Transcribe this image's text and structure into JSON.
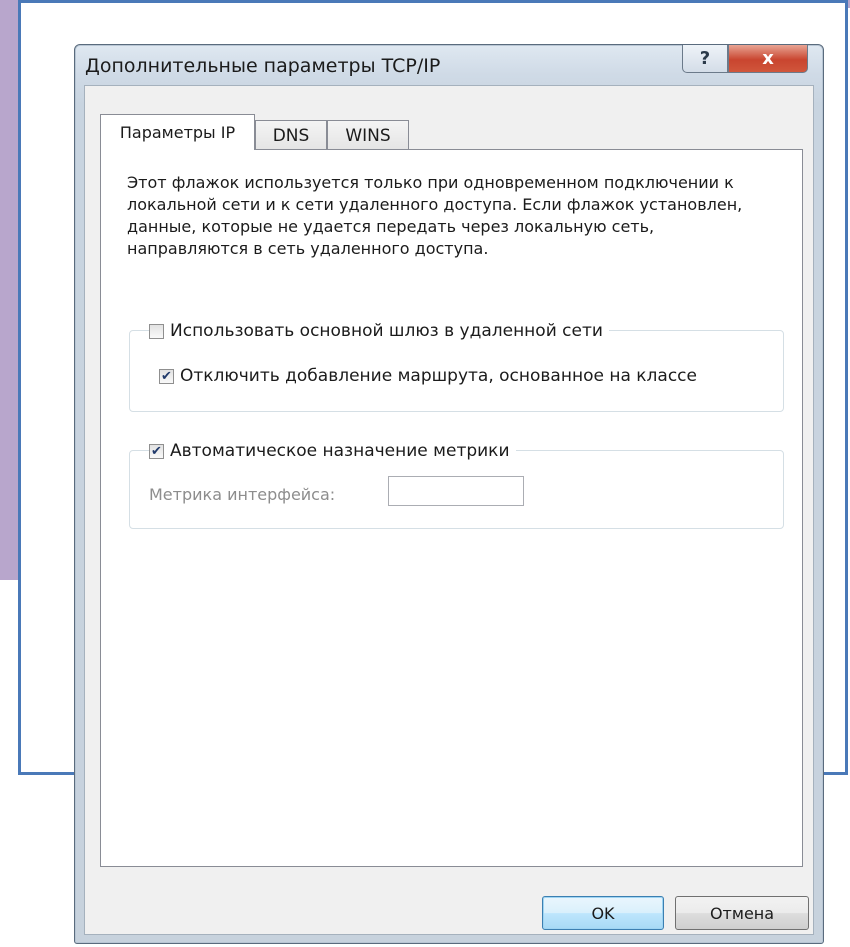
{
  "window": {
    "title": "Дополнительные параметры TCP/IP",
    "help_glyph": "?",
    "close_glyph": "x"
  },
  "tabs": [
    {
      "label": "Параметры IP",
      "active": true
    },
    {
      "label": "DNS",
      "active": false
    },
    {
      "label": "WINS",
      "active": false
    }
  ],
  "panel": {
    "description": "Этот флажок используется только при одновременном подключении к локальной сети и к сети удаленного доступа. Если флажок установлен, данные, которые не удается передать через локальную сеть, направляются в сеть удаленного доступа.",
    "use_default_gateway": {
      "label": "Использовать основной шлюз в удаленной сети",
      "checked": false
    },
    "disable_class_route": {
      "label": "Отключить добавление маршрута, основанное на классе",
      "checked": true
    },
    "auto_metric": {
      "label": "Автоматическое назначение метрики",
      "checked": true
    },
    "interface_metric_label": "Метрика интерфейса:",
    "interface_metric_value": ""
  },
  "buttons": {
    "ok": "OK",
    "cancel": "Отмена"
  },
  "colors": {
    "frame_accent": "#4a79b8",
    "background_lavender": "#b8a6cc",
    "close_button": "#c9452f",
    "default_button_border": "#3c7fb1"
  }
}
